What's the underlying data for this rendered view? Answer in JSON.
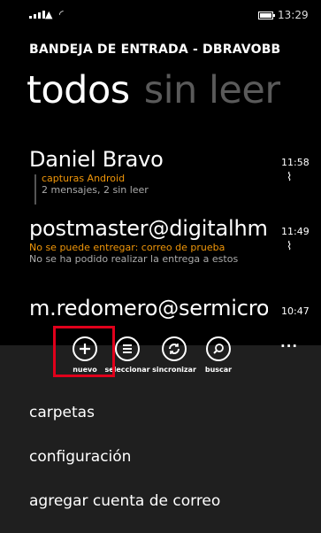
{
  "status": {
    "time": "13:29"
  },
  "account_title": "BANDEJA DE ENTRADA - DBRAVOBB",
  "pivots": {
    "active": "todos",
    "inactive": "sin leer"
  },
  "messages": [
    {
      "sender": "Daniel Bravo",
      "time": "11:58",
      "subject": "capturas Android",
      "preview": "2 mensajes, 2 sin leer",
      "attachment": true
    },
    {
      "sender": "postmaster@digitalhm",
      "time": "11:49",
      "subject": "No se puede entregar: correo de prueba",
      "preview": "No se ha podido realizar la entrega a estos",
      "attachment": true
    },
    {
      "sender": "m.redomero@sermicro",
      "time": "10:47",
      "subject": "",
      "preview": "",
      "attachment": false
    }
  ],
  "appbar": {
    "more": "...",
    "actions": [
      {
        "label": "nuevo",
        "icon": "plus-icon"
      },
      {
        "label": "seleccionar",
        "icon": "list-select-icon"
      },
      {
        "label": "sincronizar",
        "icon": "sync-icon"
      },
      {
        "label": "buscar",
        "icon": "search-icon"
      }
    ],
    "menu": [
      "carpetas",
      "configuración",
      "agregar cuenta de correo"
    ]
  },
  "colors": {
    "accent": "#f09609",
    "highlight": "#e0001b",
    "appbar_bg": "#1f1f1f",
    "inactive_pivot": "#5a5a5a"
  }
}
